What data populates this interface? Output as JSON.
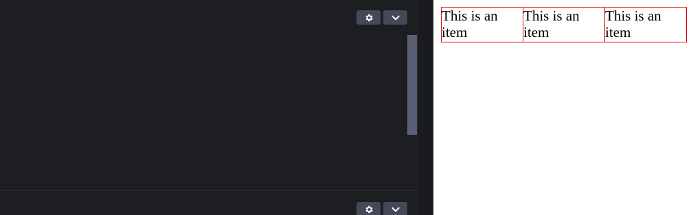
{
  "editor": {
    "top_panel": {
      "settings_icon": "gear-icon",
      "collapse_icon": "chevron-down-icon"
    },
    "bottom_panel": {
      "settings_icon": "gear-icon",
      "collapse_icon": "chevron-down-icon"
    }
  },
  "preview": {
    "items": [
      {
        "text": "This is an item"
      },
      {
        "text": "This is an item"
      },
      {
        "text": "This is an item"
      }
    ]
  },
  "colors": {
    "editor_bg": "#1d1e22",
    "button_bg": "#444857",
    "scrollbar_thumb": "#5a5f73",
    "item_border": "#e00000"
  }
}
